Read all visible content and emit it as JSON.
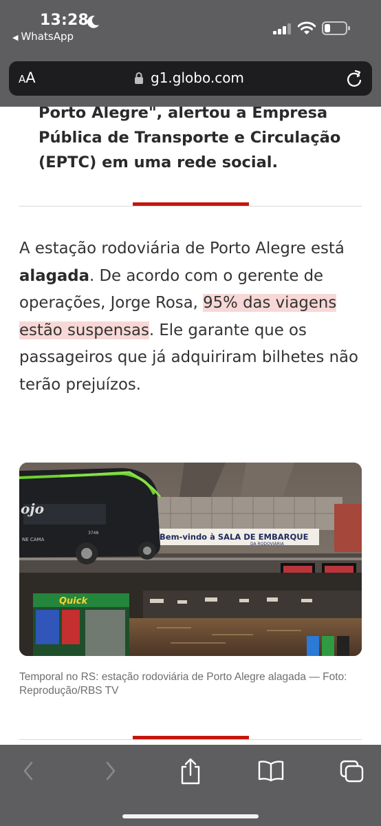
{
  "status_bar": {
    "time": "13:28",
    "back_app": "WhatsApp",
    "moon_icon": "moon-icon",
    "signal_icon": "cellular-signal-icon",
    "wifi_icon": "wifi-icon",
    "battery_icon": "battery-low-icon"
  },
  "address_bar": {
    "text_size_label_big": "A",
    "text_size_label_small": "A",
    "url": "g1.globo.com",
    "lock_icon": "lock-icon",
    "reload_icon": "reload-icon"
  },
  "article": {
    "lead_paragraph": "Porto Alegre\", alertou a Empresa Pública de Transporte e Circulação (EPTC) em uma rede social.",
    "body": {
      "part1": "A estação rodoviária de Porto Alegre está ",
      "bold": "alagada",
      "part2": ". De acordo com o gerente de operações, Jorge Rosa, ",
      "highlight": "95% das viagens estão suspensas",
      "part3": ". Ele garante que os passageiros que já adquiriram bilhetes não terão prejuízos."
    },
    "photo": {
      "sign_text": "Bem-vindo à SALA DE EMBARQUE",
      "sign_subtext": "DA RODOVIÁRIA",
      "store_sign": "Quick",
      "bus_brand": "ojo",
      "bus_sub": "NE CAMA",
      "bus_number": "3748"
    },
    "caption": "Temporal no RS: estação rodoviária de Porto Alegre alagada — Foto: Reprodução/RBS TV"
  },
  "toolbar": {
    "back_icon": "chevron-left-icon",
    "forward_icon": "chevron-right-icon",
    "share_icon": "share-icon",
    "bookmarks_icon": "book-icon",
    "tabs_icon": "tabs-icon"
  },
  "colors": {
    "accent_red": "#c4170c",
    "highlight": "#f7d8d6",
    "chrome_gray": "#5e5e60"
  }
}
